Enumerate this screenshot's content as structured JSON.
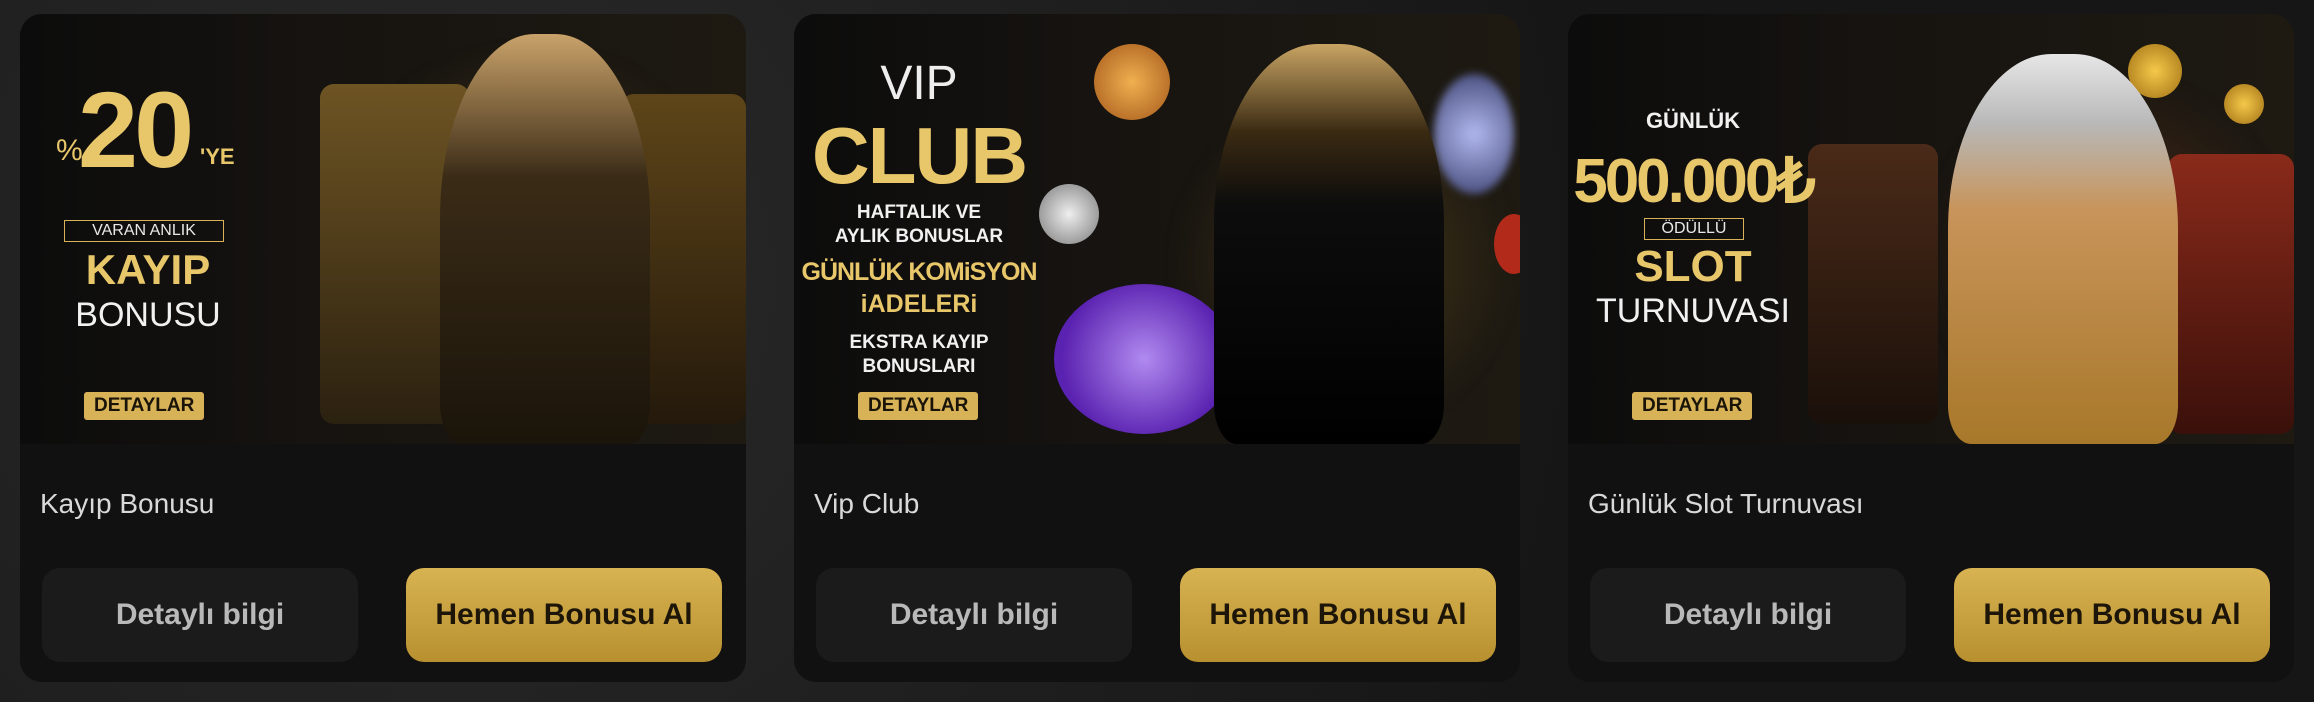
{
  "cards": [
    {
      "promo": {
        "percent_sign": "%",
        "big": "20",
        "suffix": "'YE",
        "box": "VARAN ANLIK",
        "line1": "KAYIP",
        "line2": "BONUSU",
        "chip": "DETAYLAR"
      },
      "title": "Kayıp Bonusu",
      "info_label": "Detaylı bilgi",
      "bonus_label": "Hemen Bonusu Al"
    },
    {
      "promo": {
        "vip": "VIP",
        "club": "CLUB",
        "line1": "HAFTALIK VE",
        "line2": "AYLIK BONUSLAR",
        "gold1": "GÜNLÜK KOMiSYON",
        "gold2": "iADELERi",
        "line3": "EKSTRA KAYIP",
        "line4": "BONUSLARI",
        "chip": "DETAYLAR"
      },
      "title": "Vip Club",
      "info_label": "Detaylı bilgi",
      "bonus_label": "Hemen Bonusu Al"
    },
    {
      "promo": {
        "top": "GÜNLÜK",
        "amount": "500.000₺",
        "box": "ÖDÜLLÜ",
        "line1": "SLOT",
        "line2": "TURNUVASI",
        "chip": "DETAYLAR"
      },
      "title": "Günlük Slot Turnuvası",
      "info_label": "Detaylı bilgi",
      "bonus_label": "Hemen Bonusu Al"
    }
  ],
  "colors": {
    "gold": "#d7b257",
    "card_bg": "#111111",
    "button_dark": "#1b1b1b"
  }
}
